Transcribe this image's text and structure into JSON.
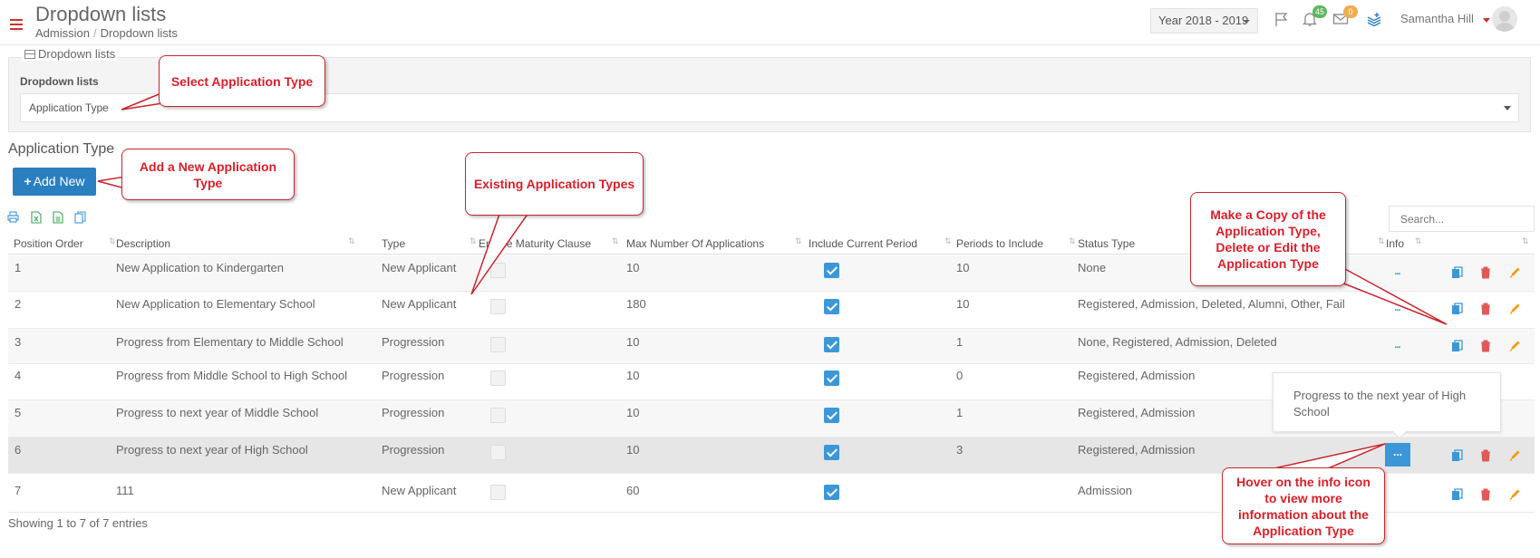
{
  "header": {
    "title": "Dropdown lists",
    "breadcrumb": [
      "Admission",
      "Dropdown lists"
    ],
    "year_select": "Year 2018 - 2019",
    "notifications_count": "45",
    "messages_count": "0",
    "user_name": "Samantha Hill",
    "colors": {
      "accent": "#c0392b",
      "primary": "#2a7fc1",
      "checkbox": "#3c97d8",
      "badge_green": "#5cb85c",
      "badge_orange": "#f0ad4e"
    }
  },
  "panel": {
    "legend": "Dropdown lists",
    "label": "Dropdown lists",
    "selected": "Application Type"
  },
  "section": {
    "title": "Application Type",
    "add_button": "Add New",
    "search_placeholder": "Search..."
  },
  "toolbar_icons": [
    "print-icon",
    "excel-icon",
    "csv-icon",
    "copy-icon"
  ],
  "table": {
    "columns": [
      "Position Order",
      "Description",
      "Type",
      "Enable Maturity Clause",
      "Max Number Of Applications",
      "Include Current Period",
      "Periods to Include",
      "Status Type",
      "Info"
    ],
    "rows": [
      {
        "position": "1",
        "description": "New Application to Kindergarten",
        "type": "New Applicant",
        "maturity": false,
        "max": "10",
        "include_current": true,
        "periods": "10",
        "status": "None"
      },
      {
        "position": "2",
        "description": "New Application to Elementary School",
        "type": "New Applicant",
        "maturity": false,
        "max": "180",
        "include_current": true,
        "periods": "10",
        "status": "Registered, Admission, Deleted, Alumni, Other, Fail"
      },
      {
        "position": "3",
        "description": "Progress from Elementary to Middle School",
        "type": "Progression",
        "maturity": false,
        "max": "10",
        "include_current": true,
        "periods": "1",
        "status": "None, Registered, Admission, Deleted"
      },
      {
        "position": "4",
        "description": "Progress from Middle School to High School",
        "type": "Progression",
        "maturity": false,
        "max": "10",
        "include_current": true,
        "periods": "0",
        "status": "Registered, Admission"
      },
      {
        "position": "5",
        "description": "Progress to next year of Middle School",
        "type": "Progression",
        "maturity": false,
        "max": "10",
        "include_current": true,
        "periods": "1",
        "status": "Registered, Admission"
      },
      {
        "position": "6",
        "description": "Progress to next year of High School",
        "type": "Progression",
        "maturity": false,
        "max": "10",
        "include_current": true,
        "periods": "3",
        "status": "Registered, Admission"
      },
      {
        "position": "7",
        "description": "111",
        "type": "New Applicant",
        "maturity": false,
        "max": "60",
        "include_current": true,
        "periods": "",
        "status": "Admission"
      }
    ],
    "footer": "Showing 1 to 7 of 7 entries",
    "info_dots": "...",
    "tooltip": "Progress to the next year of High School"
  },
  "callouts": {
    "select_type": "Select Application Type",
    "add_new": "Add a New Application Type",
    "existing": "Existing Application Types",
    "copy_delete_edit": "Make a Copy of the Application Type, Delete or Edit the Application Type",
    "hover_info": "Hover on the info icon to view more information about the Application Type"
  }
}
